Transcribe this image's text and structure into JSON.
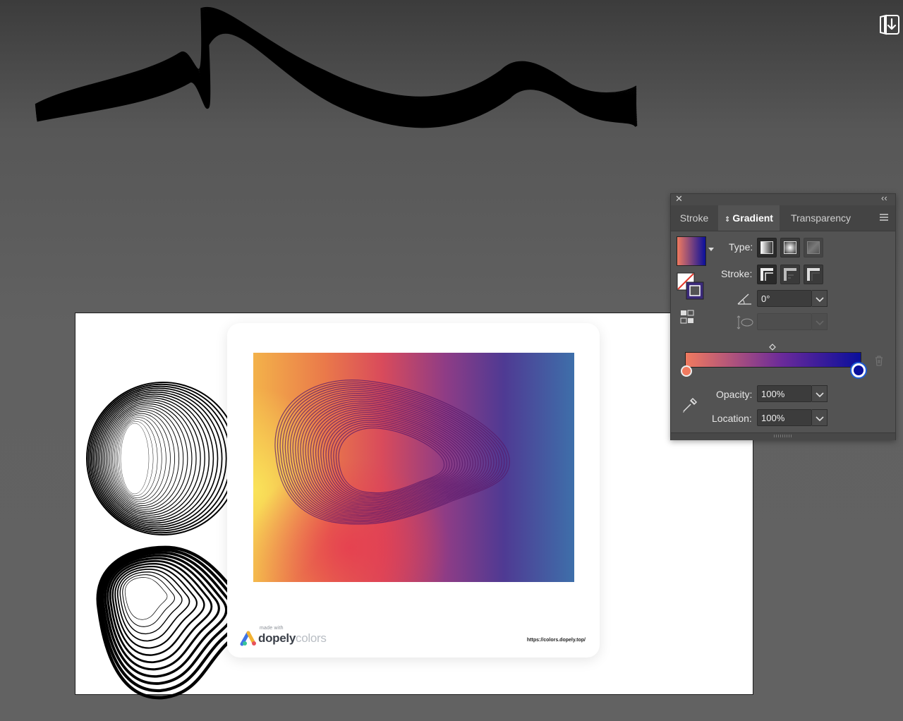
{
  "panel": {
    "tabs": [
      {
        "label": "Stroke"
      },
      {
        "label": "Gradient"
      },
      {
        "label": "Transparency"
      }
    ],
    "type_label": "Type:",
    "stroke_label": "Stroke:",
    "angle_value": "0°",
    "opacity_label": "Opacity:",
    "opacity_value": "100%",
    "location_label": "Location:",
    "location_value": "100%",
    "gradient_start_color": "#f07a5f",
    "gradient_end_color": "#0a0f9b"
  },
  "card": {
    "made_with": "made with",
    "brand_primary": "dopely",
    "brand_secondary": "colors",
    "url": "https://colors.dopely.top/"
  },
  "colors": {
    "canvas_bg": "#616161",
    "panel_bg": "#535353",
    "accent_blue": "#1d5bd6"
  },
  "icons": [
    "export-icon",
    "close-icon",
    "collapse-icon",
    "panel-menu-icon",
    "swatch-icon",
    "stroke-swatch-icon",
    "linear-type-icon",
    "radial-type-icon",
    "freeform-type-icon",
    "stroke-within-icon",
    "stroke-along-icon",
    "stroke-across-icon",
    "angle-icon",
    "aspect-ratio-icon",
    "reverse-gradient-icon",
    "eyedropper-icon",
    "trash-icon",
    "midpoint-diamond-icon"
  ]
}
